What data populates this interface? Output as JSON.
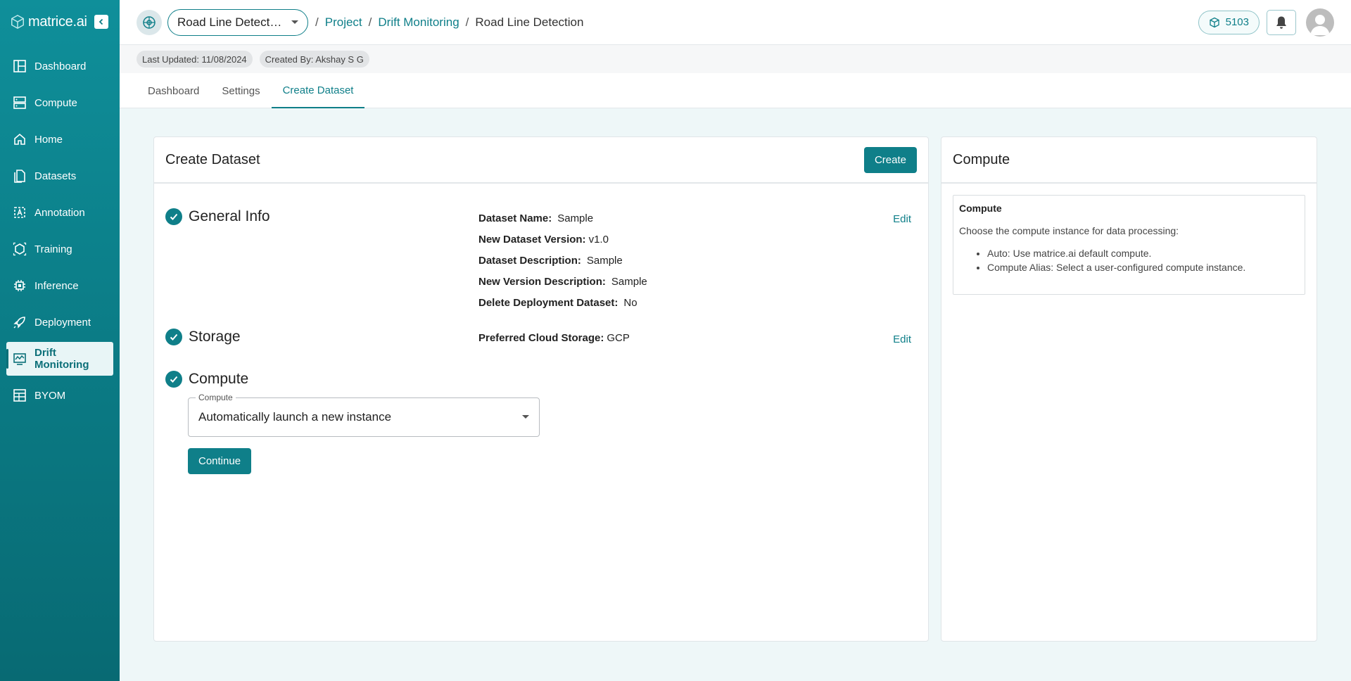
{
  "brand": {
    "name": "matrice.ai",
    "logo_icon": "cube-logo-icon",
    "collapse_icon": "chevron-left-icon"
  },
  "sidebar": {
    "items": [
      {
        "label": "Dashboard",
        "icon": "dashboard-icon",
        "active": false
      },
      {
        "label": "Compute",
        "icon": "server-icon",
        "active": false
      },
      {
        "label": "Home",
        "icon": "home-icon",
        "active": false
      },
      {
        "label": "Datasets",
        "icon": "files-icon",
        "active": false
      },
      {
        "label": "Annotation",
        "icon": "annotation-icon",
        "active": false
      },
      {
        "label": "Training",
        "icon": "training-icon",
        "active": false
      },
      {
        "label": "Inference",
        "icon": "chip-icon",
        "active": false
      },
      {
        "label": "Deployment",
        "icon": "rocket-icon",
        "active": false
      },
      {
        "label": "Drift Monitoring",
        "icon": "monitor-chart-icon",
        "active": true
      },
      {
        "label": "BYOM",
        "icon": "model-icon",
        "active": false
      }
    ]
  },
  "topbar": {
    "project_select": "Road Line Detect…",
    "breadcrumb": {
      "project": "Project",
      "section": "Drift Monitoring",
      "current": "Road Line Detection",
      "separator": "/"
    },
    "credits": "5103"
  },
  "meta": {
    "last_updated": "Last Updated: 11/08/2024",
    "created_by": "Created By: Akshay S G"
  },
  "tabs": [
    {
      "label": "Dashboard",
      "active": false
    },
    {
      "label": "Settings",
      "active": false
    },
    {
      "label": "Create Dataset",
      "active": true
    }
  ],
  "main": {
    "title": "Create Dataset",
    "create_label": "Create",
    "edit_label": "Edit",
    "general": {
      "label": "General Info",
      "fields": [
        {
          "key": "Dataset Name:",
          "value": "Sample"
        },
        {
          "key": "New Dataset Version:",
          "value": "v1.0"
        },
        {
          "key": "Dataset Description:",
          "value": "Sample"
        },
        {
          "key": "New Version Description:",
          "value": "Sample"
        },
        {
          "key": "Delete Deployment Dataset:",
          "value": "No"
        }
      ]
    },
    "storage": {
      "label": "Storage",
      "fields": [
        {
          "key": "Preferred Cloud Storage:",
          "value": "GCP"
        }
      ]
    },
    "compute": {
      "label": "Compute",
      "field_legend": "Compute",
      "field_value": "Automatically launch a new instance",
      "continue_label": "Continue"
    }
  },
  "side": {
    "title": "Compute",
    "box_heading": "Compute",
    "box_text": "Choose the compute instance for data processing:",
    "bullets": [
      "Auto: Use matrice.ai default compute.",
      "Compute Alias: Select a user-configured compute instance."
    ]
  },
  "colors": {
    "accent": "#0f7f89",
    "sidebar": "#0b7c86"
  }
}
